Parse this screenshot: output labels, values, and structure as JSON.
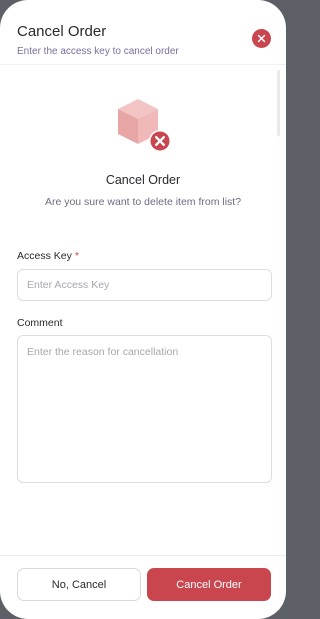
{
  "header": {
    "title": "Cancel Order",
    "subtitle": "Enter the access key to cancel order"
  },
  "icons": {
    "close": "close-icon",
    "illustration": "box-cancel-icon"
  },
  "confirm": {
    "title": "Cancel Order",
    "message": "Are you sure want to delete item from list?"
  },
  "form": {
    "access_key": {
      "label": "Access Key",
      "required_mark": "*",
      "value": "",
      "placeholder": "Enter Access Key"
    },
    "comment": {
      "label": "Comment",
      "value": "",
      "placeholder": "Enter the reason for cancellation"
    }
  },
  "footer": {
    "cancel_label": "No, Cancel",
    "confirm_label": "Cancel Order"
  },
  "colors": {
    "accent": "#c9464f",
    "box_light": "#f2c4c4",
    "box_dark": "#e7a5a6"
  }
}
